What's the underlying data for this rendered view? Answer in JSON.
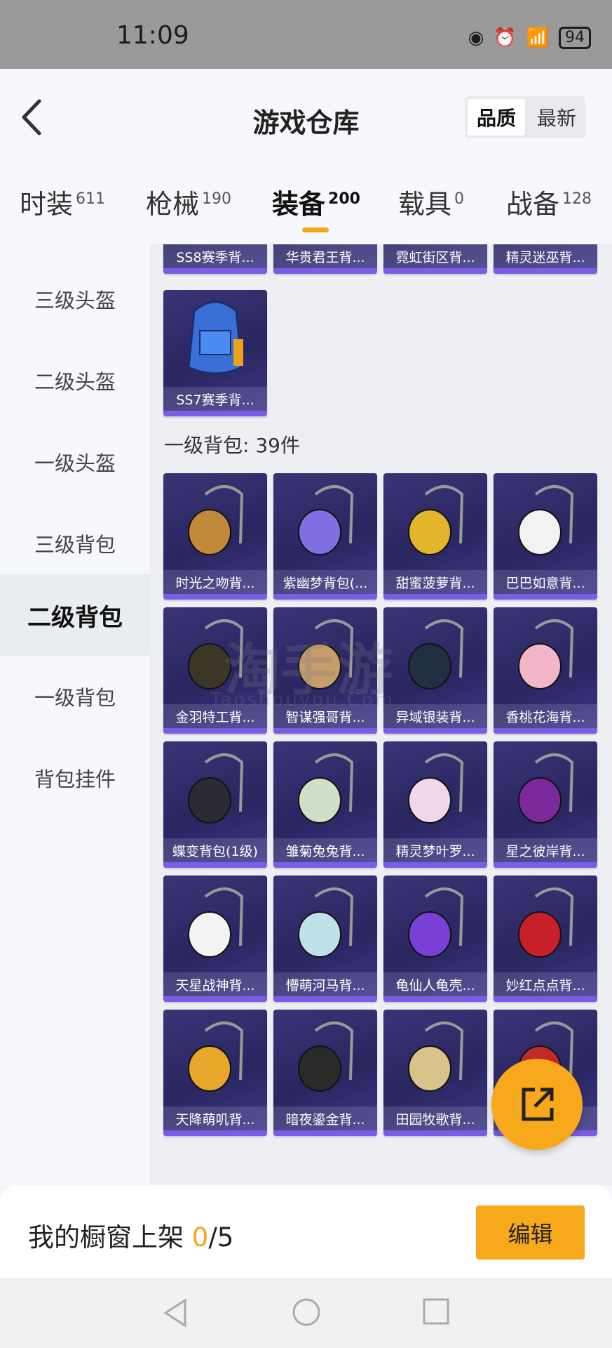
{
  "status_bar": {
    "time": "11:09",
    "battery": "94"
  },
  "header": {
    "title": "游戏仓库",
    "sort": [
      "品质",
      "最新"
    ]
  },
  "tabs": [
    {
      "label": "时装",
      "count": "611"
    },
    {
      "label": "枪械",
      "count": "190"
    },
    {
      "label": "装备",
      "count": "200"
    },
    {
      "label": "载具",
      "count": "0"
    },
    {
      "label": "战备",
      "count": "128"
    }
  ],
  "sidebar": [
    "三级头盔",
    "二级头盔",
    "一级头盔",
    "三级背包",
    "二级背包",
    "一级背包",
    "背包挂件"
  ],
  "top_items": [
    "SS8赛季背...",
    "华贵君王背...",
    "霓虹街区背...",
    "精灵迷巫背...",
    "SS7赛季背..."
  ],
  "section_title": "一级背包: 39件",
  "items": [
    "时光之吻背...",
    "紫幽梦背包(...",
    "甜蜜菠萝背...",
    "巴巴如意背...",
    "金羽特工背...",
    "智谋强哥背...",
    "异域银装背...",
    "香桃花海背...",
    "蝶变背包(1级)",
    "雏菊兔兔背...",
    "精灵梦叶罗...",
    "星之彼岸背...",
    "天星战神背...",
    "懵萌河马背...",
    "龟仙人龟壳...",
    "妙红点点背...",
    "天降萌叽背...",
    "暗夜鎏金背...",
    "田园牧歌背...",
    ""
  ],
  "watermark": {
    "main": "淘手游",
    "sub": "Taoshouyou.Com"
  },
  "footer": {
    "prefix": "我的橱窗上架 ",
    "count": "0",
    "total": "/5",
    "edit_label": "编辑"
  },
  "colors": {
    "accent": "#f7a81b",
    "card_bg": "#2a2660",
    "card_bar": "#7a5ce6"
  }
}
